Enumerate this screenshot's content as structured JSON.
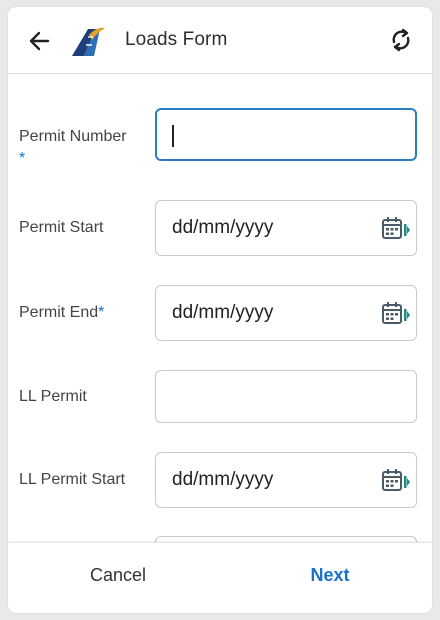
{
  "header": {
    "title": "Loads Form",
    "back_icon": "arrow-left-icon",
    "logo_icon": "road-logo-icon",
    "sync_icon": "sync-icon"
  },
  "form": {
    "fields": [
      {
        "label": "Permit Number",
        "required": true,
        "type": "text",
        "value": "",
        "focused": true
      },
      {
        "label": "Permit Start",
        "required": false,
        "type": "date",
        "placeholder": "dd/mm/yyyy"
      },
      {
        "label": "Permit End",
        "required": true,
        "type": "date",
        "placeholder": "dd/mm/yyyy"
      },
      {
        "label": "LL Permit",
        "required": false,
        "type": "text",
        "value": ""
      },
      {
        "label": "LL Permit Start",
        "required": false,
        "type": "date",
        "placeholder": "dd/mm/yyyy"
      }
    ],
    "required_marker": "*"
  },
  "footer": {
    "cancel_label": "Cancel",
    "next_label": "Next"
  },
  "colors": {
    "accent": "#1a73c8",
    "focus_border": "#2a7fc4",
    "calendar_icon": "#4a5a66",
    "calendar_accent": "#1e8a86"
  }
}
